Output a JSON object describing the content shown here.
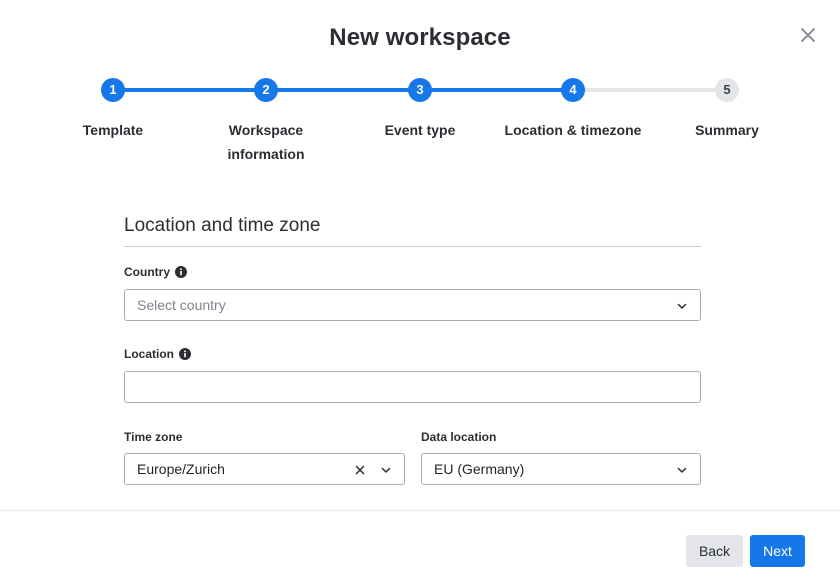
{
  "dialog": {
    "title": "New workspace"
  },
  "stepper": {
    "steps": [
      {
        "number": "1",
        "label": "Template",
        "state": "done"
      },
      {
        "number": "2",
        "label": "Workspace information",
        "state": "done"
      },
      {
        "number": "3",
        "label": "Event type",
        "state": "done"
      },
      {
        "number": "4",
        "label": "Location & timezone",
        "state": "current"
      },
      {
        "number": "5",
        "label": "Summary",
        "state": "pending"
      }
    ]
  },
  "section": {
    "title": "Location and time zone"
  },
  "fields": {
    "country": {
      "label": "Country",
      "placeholder": "Select country",
      "value": ""
    },
    "location": {
      "label": "Location",
      "value": ""
    },
    "time_zone": {
      "label": "Time zone",
      "value": "Europe/Zurich"
    },
    "data_location": {
      "label": "Data location",
      "value": "EU (Germany)"
    }
  },
  "footer": {
    "back_label": "Back",
    "next_label": "Next"
  },
  "colors": {
    "accent": "#1677e8",
    "inactive": "#e3e5e8",
    "text": "#2b2f33"
  },
  "icons": {
    "close": "close-icon",
    "info": "info-icon",
    "chevron": "chevron-down-icon",
    "clear": "clear-icon"
  }
}
